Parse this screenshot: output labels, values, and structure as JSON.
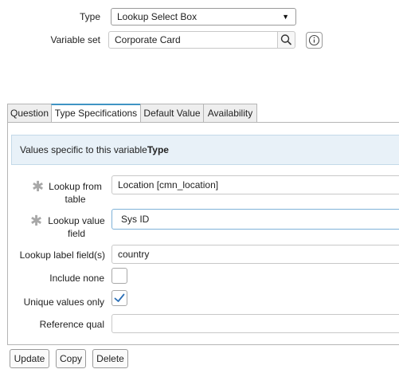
{
  "header": {
    "type_label": "Type",
    "type_value": "Lookup Select Box",
    "variable_set_label": "Variable set",
    "variable_set_value": "Corporate Card"
  },
  "tabs": [
    {
      "label": "Question"
    },
    {
      "label": "Type Specifications",
      "active": true
    },
    {
      "label": "Default Value"
    },
    {
      "label": "Availability"
    }
  ],
  "panel": {
    "info_text": "Values specific to this variable",
    "info_text_bold": "Type",
    "fields": {
      "lookup_from_table": {
        "label_line1": "Lookup from",
        "label_line2": "table",
        "value": "Location [cmn_location]",
        "mandatory": true
      },
      "lookup_value_field": {
        "label_line1": "Lookup value",
        "label_line2": "field",
        "value": "Sys ID",
        "mandatory": true
      },
      "lookup_label_fields": {
        "label": "Lookup label field(s)",
        "value": "country"
      },
      "include_none": {
        "label": "Include none",
        "checked": false
      },
      "unique_values_only": {
        "label": "Unique values only",
        "checked": true
      },
      "reference_qual": {
        "label": "Reference qual",
        "value": ""
      }
    }
  },
  "buttons": {
    "update": "Update",
    "copy": "Copy",
    "delete": "Delete"
  },
  "colors": {
    "accent": "#3f94c4",
    "check": "#2b6fb6",
    "info_bg": "#e8f1f8"
  }
}
